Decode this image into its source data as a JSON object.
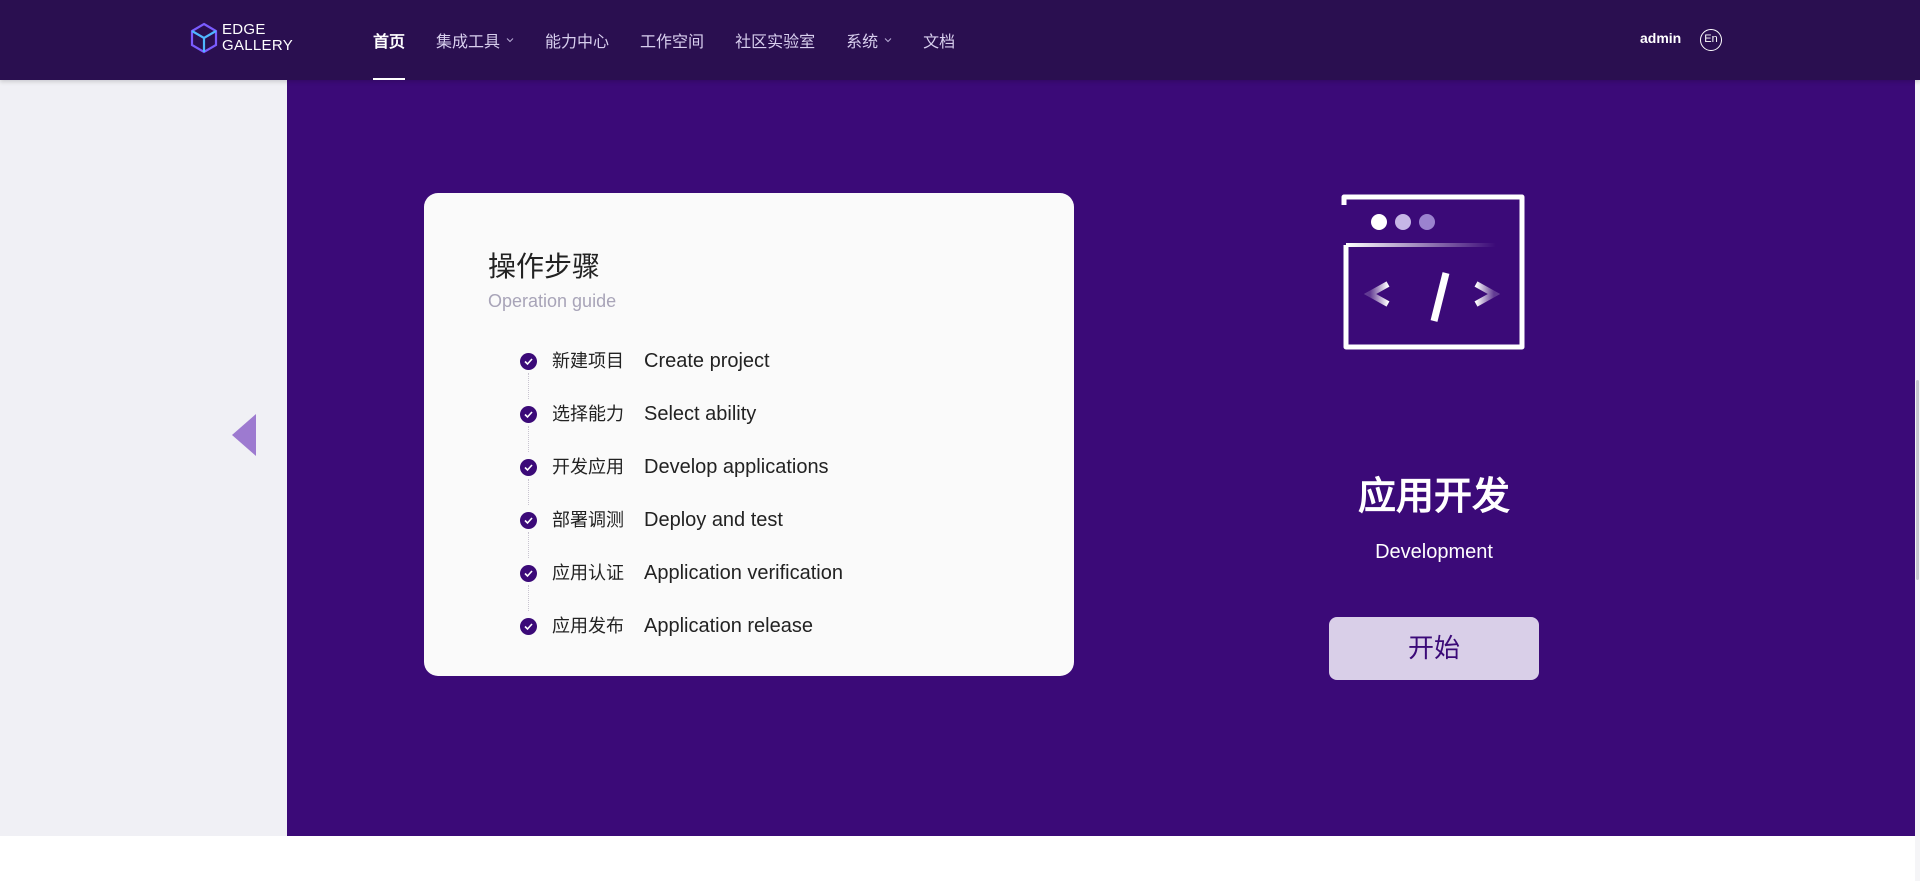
{
  "header": {
    "logo_line1": "EDGE",
    "logo_line2": "GALLERY",
    "nav": [
      {
        "label": "首页",
        "active": true,
        "dropdown": false
      },
      {
        "label": "集成工具",
        "active": false,
        "dropdown": true
      },
      {
        "label": "能力中心",
        "active": false,
        "dropdown": false
      },
      {
        "label": "工作空间",
        "active": false,
        "dropdown": false
      },
      {
        "label": "社区实验室",
        "active": false,
        "dropdown": false
      },
      {
        "label": "系统",
        "active": false,
        "dropdown": true
      },
      {
        "label": "文档",
        "active": false,
        "dropdown": false
      }
    ],
    "user": "admin",
    "lang": "En"
  },
  "card": {
    "title": "操作步骤",
    "subtitle": "Operation guide",
    "steps": [
      {
        "cn": "新建项目",
        "en": "Create project"
      },
      {
        "cn": "选择能力",
        "en": "Select ability"
      },
      {
        "cn": "开发应用",
        "en": "Develop applications"
      },
      {
        "cn": "部署调测",
        "en": "Deploy and test"
      },
      {
        "cn": "应用认证",
        "en": "Application verification"
      },
      {
        "cn": "应用发布",
        "en": "Application release"
      }
    ]
  },
  "feature": {
    "title_cn": "应用开发",
    "title_en": "Development",
    "start_label": "开始"
  },
  "colors": {
    "header_bg": "#2a0f50",
    "purple_bg": "#3b0a78",
    "accent": "#3b0a78",
    "button_bg": "#d9cfe8"
  }
}
